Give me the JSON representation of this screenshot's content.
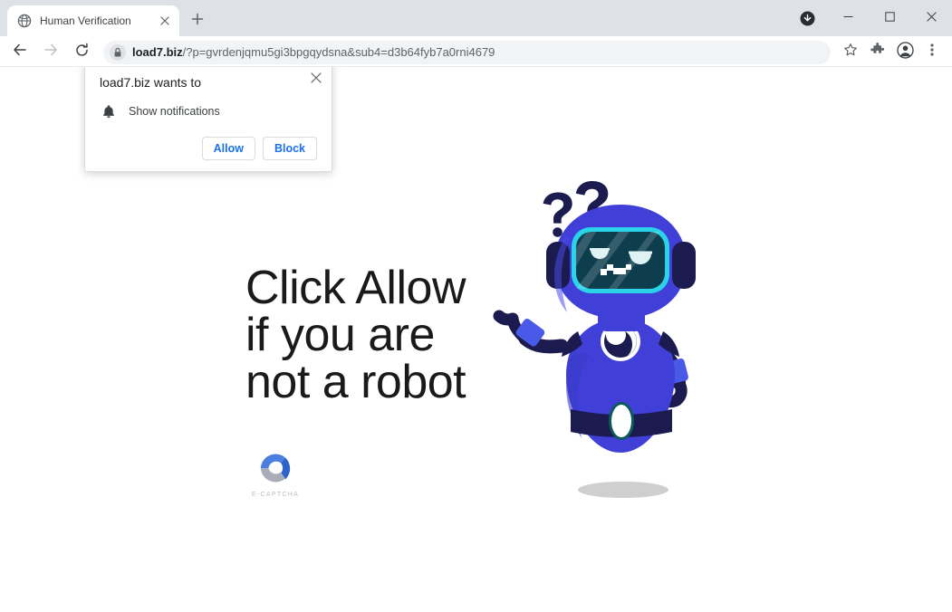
{
  "browser": {
    "tab": {
      "title": "Human Verification",
      "favicon_icon": "globe-icon",
      "close_icon": "close-icon"
    },
    "new_tab_icon": "plus-icon",
    "window_controls": {
      "download_icon": "download-indicator-icon",
      "minimize_icon": "minimize-icon",
      "maximize_icon": "maximize-icon",
      "close_icon": "window-close-icon"
    },
    "toolbar": {
      "back_icon": "back-arrow-icon",
      "forward_icon": "forward-arrow-icon",
      "reload_icon": "reload-icon",
      "lock_icon": "lock-icon",
      "url_domain": "load7.biz",
      "url_path": "/?p=gvrdenjqmu5gi3bpgqydsna&sub4=d3b64fyb7a0rni4679",
      "url_full": "load7.biz/?p=gvrdenjqmu5gi3bpgqydsna&sub4=d3b64fyb7a0rni4679",
      "bookmark_icon": "star-icon",
      "extensions_icon": "puzzle-piece-icon",
      "profile_icon": "profile-avatar-icon",
      "menu_icon": "three-dot-menu-icon"
    }
  },
  "permission_prompt": {
    "title": "load7.biz wants to",
    "permission_icon": "bell-icon",
    "permission_label": "Show notifications",
    "allow_label": "Allow",
    "block_label": "Block",
    "close_icon": "close-icon"
  },
  "page": {
    "headline": "Click Allow if you are not a robot",
    "captcha_label": "E-CAPTCHA",
    "captcha_logo_icon": "captcha-c-logo-icon",
    "robot_illustration_icon": "confused-robot-illustration"
  },
  "colors": {
    "accent_blue": "#1a73e8",
    "robot_body": "#4040d8",
    "robot_dark": "#1b1b4f",
    "visor_teal": "#0e3d4d",
    "visor_border": "#2ad4e8",
    "captcha_blue": "#4a7fe0",
    "captcha_gray": "#9aa0a6",
    "chrome_tabstrip": "#dee1e6"
  }
}
